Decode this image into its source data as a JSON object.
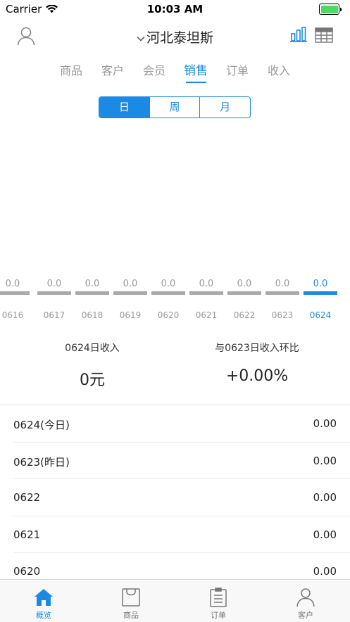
{
  "status": {
    "carrier": "Carrier",
    "time": "10:03 AM"
  },
  "header": {
    "title": "河北泰坦斯"
  },
  "tabs": [
    {
      "label": "商品"
    },
    {
      "label": "客户"
    },
    {
      "label": "会员"
    },
    {
      "label": "销售"
    },
    {
      "label": "订单"
    },
    {
      "label": "收入"
    }
  ],
  "active_tab": "销售",
  "segment": [
    {
      "label": "日"
    },
    {
      "label": "周"
    },
    {
      "label": "月"
    }
  ],
  "active_segment": "日",
  "bars": [
    {
      "value": "0.0",
      "date": "0616"
    },
    {
      "value": "0.0",
      "date": "0617"
    },
    {
      "value": "0.0",
      "date": "0618"
    },
    {
      "value": "0.0",
      "date": "0619"
    },
    {
      "value": "0.0",
      "date": "0620"
    },
    {
      "value": "0.0",
      "date": "0621"
    },
    {
      "value": "0.0",
      "date": "0622"
    },
    {
      "value": "0.0",
      "date": "0623"
    },
    {
      "value": "0.0",
      "date": "0624"
    }
  ],
  "active_bar": "0624",
  "summary": {
    "left_label": "0624日收入",
    "left_value": "0元",
    "right_label": "与0623日收入环比",
    "right_value": "+0.00%"
  },
  "list": [
    {
      "label": "0624(今日)",
      "value": "0.00"
    },
    {
      "label": "0623(昨日)",
      "value": "0.00"
    },
    {
      "label": "0622",
      "value": "0.00"
    },
    {
      "label": "0621",
      "value": "0.00"
    },
    {
      "label": "0620",
      "value": "0.00"
    }
  ],
  "tabbar": [
    {
      "label": "概览",
      "icon": "home-icon"
    },
    {
      "label": "商品",
      "icon": "shopping-bag-icon"
    },
    {
      "label": "订单",
      "icon": "clipboard-icon"
    },
    {
      "label": "客户",
      "icon": "person-icon"
    }
  ],
  "active_tabbar": "概览",
  "colors": {
    "accent": "#1a8ae5",
    "inactive_bar": "#aaaaaa",
    "muted_text": "#999999"
  }
}
